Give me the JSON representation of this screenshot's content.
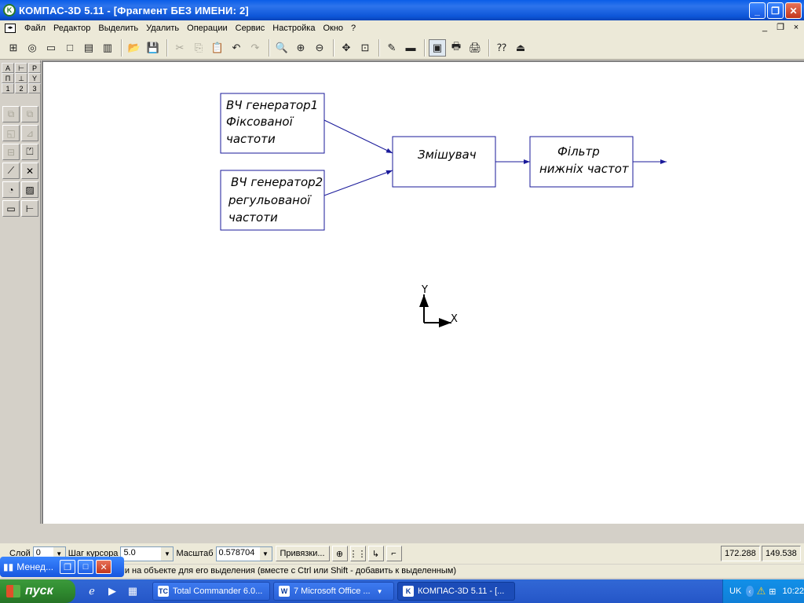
{
  "window": {
    "title": "КОМПАС-3D 5.11 - [Фрагмент БЕЗ ИМЕНИ: 2]",
    "app_icon": "kompas-logo-icon",
    "controls": {
      "minimize": "_",
      "maximize": "❐",
      "close": "✕"
    }
  },
  "menu": {
    "items": [
      "Файл",
      "Редактор",
      "Выделить",
      "Удалить",
      "Операции",
      "Сервис",
      "Настройка",
      "Окно",
      "?"
    ],
    "mdi_controls": {
      "minimize": "_",
      "restore": "❐",
      "close": "×"
    }
  },
  "toolbar": {
    "buttons": [
      {
        "icon": "new-assembly-icon",
        "glyph": "⊞",
        "state": "normal"
      },
      {
        "icon": "new-part-icon",
        "glyph": "◎",
        "state": "normal"
      },
      {
        "icon": "new-drawing-icon",
        "glyph": "▭",
        "state": "normal"
      },
      {
        "icon": "new-fragment-icon",
        "glyph": "□",
        "state": "normal"
      },
      {
        "icon": "new-text-document-icon",
        "glyph": "▤",
        "state": "normal"
      },
      {
        "icon": "new-specification-icon",
        "glyph": "▥",
        "state": "normal"
      },
      {
        "sep": true
      },
      {
        "icon": "open-folder-icon",
        "glyph": "📂",
        "state": "normal"
      },
      {
        "icon": "save-icon",
        "glyph": "💾",
        "state": "normal"
      },
      {
        "sep": true
      },
      {
        "icon": "cut-icon",
        "glyph": "✂",
        "state": "disabled"
      },
      {
        "icon": "copy-icon",
        "glyph": "⎘",
        "state": "disabled"
      },
      {
        "icon": "paste-icon",
        "glyph": "📋",
        "state": "normal"
      },
      {
        "icon": "undo-icon",
        "glyph": "↶",
        "state": "normal"
      },
      {
        "icon": "redo-icon",
        "glyph": "↷",
        "state": "disabled"
      },
      {
        "sep": true
      },
      {
        "icon": "zoom-window-icon",
        "glyph": "🔍",
        "state": "normal"
      },
      {
        "icon": "zoom-in-icon",
        "glyph": "⊕",
        "state": "normal"
      },
      {
        "icon": "zoom-out-icon",
        "glyph": "⊖",
        "state": "normal"
      },
      {
        "sep": true
      },
      {
        "icon": "pan-icon",
        "glyph": "✥",
        "state": "normal"
      },
      {
        "icon": "show-all-icon",
        "glyph": "⊡",
        "state": "normal"
      },
      {
        "sep": true
      },
      {
        "icon": "redraw-icon",
        "glyph": "✎",
        "state": "normal"
      },
      {
        "icon": "object-properties-icon",
        "glyph": "▬",
        "state": "normal"
      },
      {
        "sep": true
      },
      {
        "icon": "manager-icon",
        "glyph": "▣",
        "state": "active"
      },
      {
        "icon": "print-preview-icon",
        "glyph": "🖶",
        "state": "normal"
      },
      {
        "icon": "print-icon",
        "glyph": "🖨",
        "state": "normal"
      },
      {
        "sep": true
      },
      {
        "icon": "help-pointer-icon",
        "glyph": "⁇",
        "state": "normal"
      },
      {
        "icon": "exit-icon",
        "glyph": "⏏",
        "state": "normal"
      }
    ]
  },
  "left_panel": {
    "top_grid": [
      [
        "A",
        "⊢",
        "P"
      ],
      [
        "П",
        "⊥",
        "Y"
      ],
      [
        "1",
        "2",
        "3"
      ]
    ],
    "tools": [
      {
        "icon": "copy-object-icon",
        "glyph": "⧉",
        "active": false
      },
      {
        "icon": "move-object-icon",
        "glyph": "⧉",
        "active": false
      },
      {
        "icon": "rotate-object-icon",
        "glyph": "◱",
        "active": false
      },
      {
        "icon": "scale-object-icon",
        "glyph": "⊿",
        "active": false
      },
      {
        "icon": "mirror-object-icon",
        "glyph": "⊟",
        "active": false
      },
      {
        "icon": "deform-object-icon",
        "glyph": "⏍",
        "active": true
      },
      {
        "icon": "trim-curve-icon",
        "glyph": "⟋",
        "active": true
      },
      {
        "icon": "break-curve-icon",
        "glyph": "✕",
        "active": true
      },
      {
        "icon": "fillet-icon",
        "glyph": "◔",
        "active": true
      },
      {
        "icon": "hatch-icon",
        "glyph": "▨",
        "active": true
      },
      {
        "icon": "equidistant-icon",
        "glyph": "▭",
        "active": true
      },
      {
        "icon": "break-line-icon",
        "glyph": "⊢",
        "active": true
      }
    ]
  },
  "diagram": {
    "blocks": [
      {
        "id": "gen1",
        "lines": [
          "ВЧ генератор1",
          "Фіксованої",
          "частоти"
        ]
      },
      {
        "id": "gen2",
        "lines": [
          "ВЧ генератор2",
          "регульованої",
          "частоти"
        ]
      },
      {
        "id": "mixer",
        "lines": [
          "Змішувач"
        ]
      },
      {
        "id": "filter",
        "lines": [
          "Фільтр",
          "нижніх частот"
        ]
      }
    ],
    "connections": [
      {
        "from": "gen1",
        "to": "mixer"
      },
      {
        "from": "gen2",
        "to": "mixer"
      },
      {
        "from": "mixer",
        "to": "filter"
      },
      {
        "from": "filter",
        "to": "output"
      }
    ],
    "axes": {
      "x_label": "X",
      "y_label": "Y"
    },
    "line_color": "#1a1a9a",
    "box_color": "#1a1a9a"
  },
  "statusbar": {
    "layer_label": "Слой",
    "layer_value": "0",
    "step_label": "Шаг курсора",
    "step_value": "5.0",
    "scale_label": "Масштаб",
    "scale_value": "0.578704",
    "snaps_button": "Привязки...",
    "icons": [
      "snap-settings-icon",
      "grid-icon",
      "orthogonal-mode-icon",
      "step-mode-icon"
    ],
    "coord_x": "172.288",
    "coord_y": "149.538"
  },
  "hint": {
    "text": "ши на объекте для его выделения (вместе с Ctrl или Shift - добавить к выделенным)"
  },
  "manager_window": {
    "label": "Менед...",
    "restore": "❐",
    "maximize": "□",
    "close": "✕"
  },
  "taskbar": {
    "start_label": "пуск",
    "quicklaunch": [
      "internet-explorer-icon",
      "media-player-icon",
      "show-desktop-icon"
    ],
    "tasks": [
      {
        "label": "Total Commander 6.0...",
        "icon": "total-commander-icon",
        "active": false
      },
      {
        "label": "7 Microsoft Office ...",
        "icon": "word-icon",
        "active": false
      },
      {
        "label": "КОМПАС-3D 5.11 - [...",
        "icon": "kompas-logo-icon",
        "active": true
      }
    ],
    "tray": {
      "language": "UK",
      "time": "10:22"
    }
  }
}
